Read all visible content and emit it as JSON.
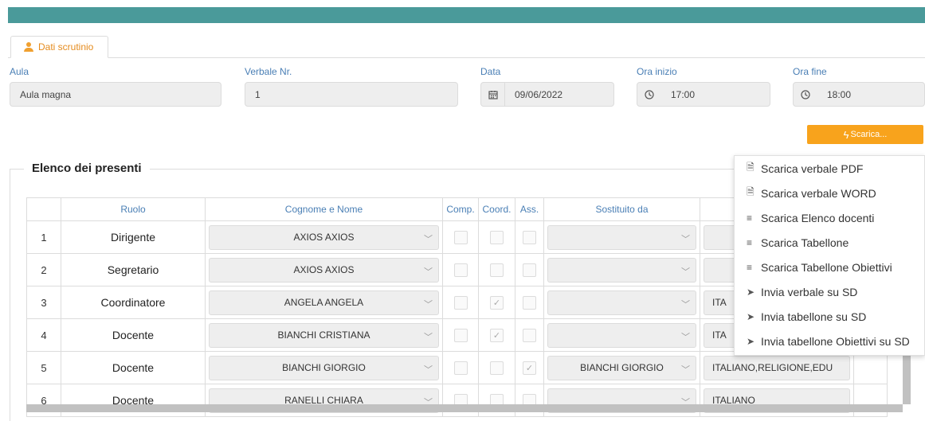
{
  "tab": {
    "label": "Dati scrutinio",
    "icon": "user-icon"
  },
  "fields": {
    "aula": {
      "label": "Aula",
      "value": "Aula magna"
    },
    "verbale": {
      "label": "Verbale Nr.",
      "value": "1"
    },
    "data": {
      "label": "Data",
      "value": "09/06/2022",
      "icon": "calendar-icon"
    },
    "ora_inizio": {
      "label": "Ora inizio",
      "value": "17:00",
      "icon": "clock-icon"
    },
    "ora_fine": {
      "label": "Ora fine",
      "value": "18:00",
      "icon": "clock-icon"
    }
  },
  "scarica": {
    "label": "Scarica...",
    "icon": "bolt-icon"
  },
  "menu": {
    "items": [
      {
        "label": "Scarica verbale PDF",
        "icon": "file-icon"
      },
      {
        "label": "Scarica verbale WORD",
        "icon": "file-icon"
      },
      {
        "label": "Scarica Elenco docenti",
        "icon": "list-icon"
      },
      {
        "label": "Scarica Tabellone",
        "icon": "list-icon"
      },
      {
        "label": "Scarica Tabellone Obiettivi",
        "icon": "list-icon"
      },
      {
        "label": "Invia verbale su SD",
        "icon": "send-icon"
      },
      {
        "label": "Invia tabellone su SD",
        "icon": "send-icon"
      },
      {
        "label": "Invia tabellone Obiettivi su SD",
        "icon": "send-icon"
      }
    ]
  },
  "presenti": {
    "legend": "Elenco dei presenti",
    "headers": {
      "ruolo": "Ruolo",
      "nome": "Cognome e Nome",
      "comp": "Comp.",
      "coord": "Coord.",
      "ass": "Ass.",
      "sostituito": "Sostituito da"
    },
    "rows": [
      {
        "num": "1",
        "ruolo": "Dirigente",
        "nome": "AXIOS AXIOS",
        "coord": false,
        "ass": false,
        "sostituito": "",
        "materie": ""
      },
      {
        "num": "2",
        "ruolo": "Segretario",
        "nome": "AXIOS AXIOS",
        "coord": false,
        "ass": false,
        "sostituito": "",
        "materie": ""
      },
      {
        "num": "3",
        "ruolo": "Coordinatore",
        "nome": "ANGELA ANGELA",
        "coord": true,
        "ass": false,
        "sostituito": "",
        "materie": "ITA"
      },
      {
        "num": "4",
        "ruolo": "Docente",
        "nome": "BIANCHI CRISTIANA",
        "coord": true,
        "ass": false,
        "sostituito": "",
        "materie": "ITA"
      },
      {
        "num": "5",
        "ruolo": "Docente",
        "nome": "BIANCHI GIORGIO",
        "coord": false,
        "ass": true,
        "sostituito": "BIANCHI GIORGIO",
        "materie": "ITALIANO,RELIGIONE,EDU"
      },
      {
        "num": "6",
        "ruolo": "Docente",
        "nome": "RANELLI CHIARA",
        "coord": false,
        "ass": false,
        "sostituito": "",
        "materie": "ITALIANO"
      }
    ]
  }
}
